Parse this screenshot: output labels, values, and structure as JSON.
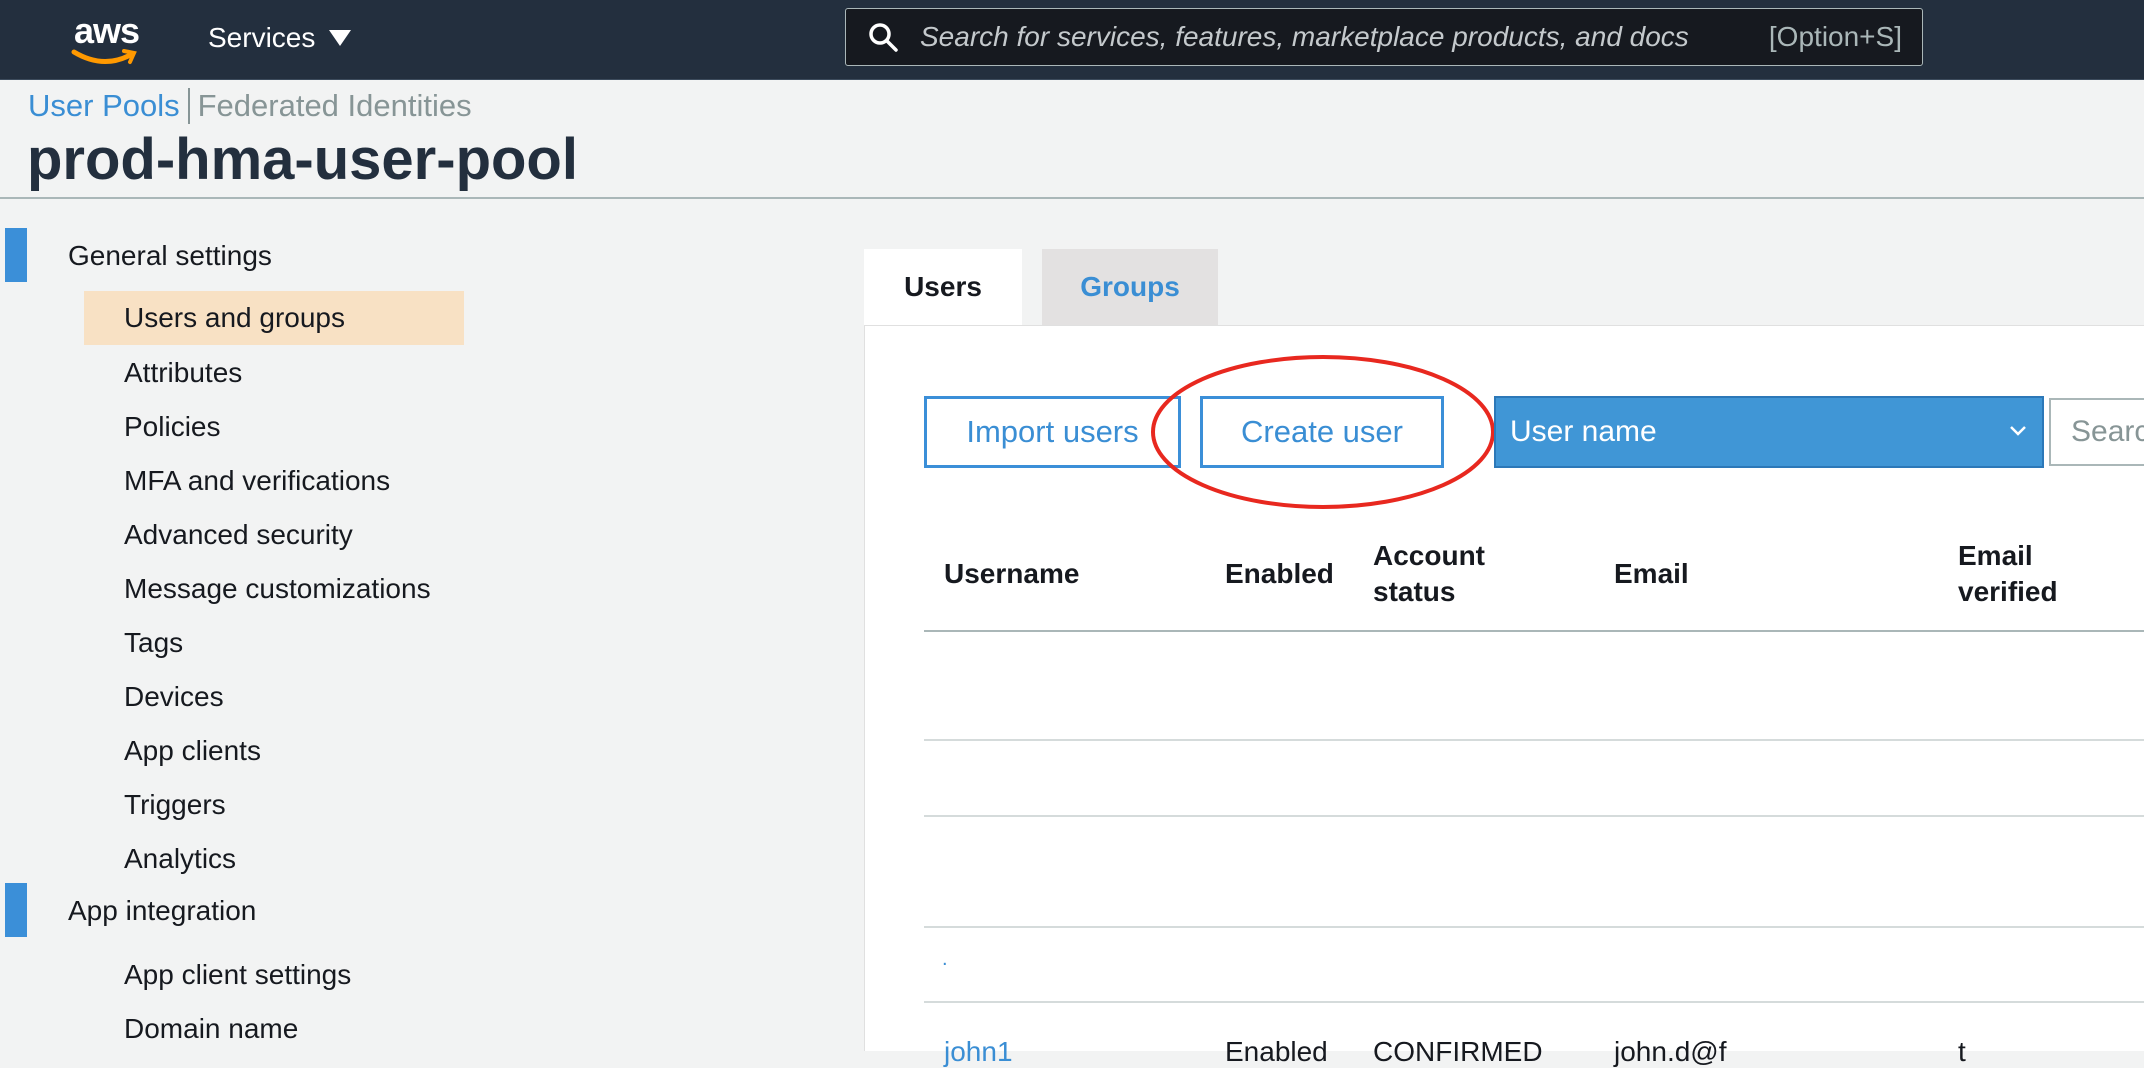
{
  "topbar": {
    "logo_text": "aws",
    "services_label": "Services",
    "search_placeholder": "Search for services, features, marketplace products, and docs",
    "search_shortcut": "[Option+S]"
  },
  "breadcrumb": {
    "active": "User Pools",
    "inactive": "Federated Identities"
  },
  "page_title": "prod-hma-user-pool",
  "sidebar": {
    "sections": [
      {
        "label": "General settings",
        "items": [
          {
            "label": "Users and groups",
            "active": true
          },
          {
            "label": "Attributes"
          },
          {
            "label": "Policies"
          },
          {
            "label": "MFA and verifications"
          },
          {
            "label": "Advanced security"
          },
          {
            "label": "Message customizations"
          },
          {
            "label": "Tags"
          },
          {
            "label": "Devices"
          },
          {
            "label": "App clients"
          },
          {
            "label": "Triggers"
          },
          {
            "label": "Analytics"
          }
        ]
      },
      {
        "label": "App integration",
        "items": [
          {
            "label": "App client settings"
          },
          {
            "label": "Domain name"
          }
        ]
      }
    ]
  },
  "tabs": [
    {
      "label": "Users",
      "selected": true
    },
    {
      "label": "Groups",
      "selected": false
    }
  ],
  "toolbar": {
    "import_label": "Import users",
    "create_label": "Create user",
    "filter_selected": "User name",
    "search_placeholder": "Search"
  },
  "table": {
    "columns": [
      "Username",
      "Enabled",
      "Account status",
      "Email",
      "Email verified"
    ],
    "column_lines": {
      "account_status": [
        "Account",
        "status"
      ],
      "email_verified": [
        "Email",
        "verified"
      ]
    },
    "rows": [
      {
        "username": "",
        "enabled": "",
        "status": "",
        "email": "",
        "verified": ""
      },
      {
        "username": "",
        "enabled": "",
        "status": "",
        "email": "",
        "verified": ""
      },
      {
        "username": "",
        "enabled": "",
        "status": "",
        "email": "",
        "verified": ""
      },
      {
        "username": ".",
        "enabled": "",
        "status": "",
        "email": "",
        "verified": ""
      },
      {
        "username": "john1",
        "enabled": "Enabled",
        "status": "CONFIRMED",
        "email": "john.d@f",
        "verified": "t"
      }
    ]
  },
  "colors": {
    "nav_bg": "#232f3e",
    "link_blue": "#3a8ed4",
    "select_blue": "#4096d6",
    "active_item_bg": "#f8e1c4",
    "annotation_red": "#e8281f"
  }
}
